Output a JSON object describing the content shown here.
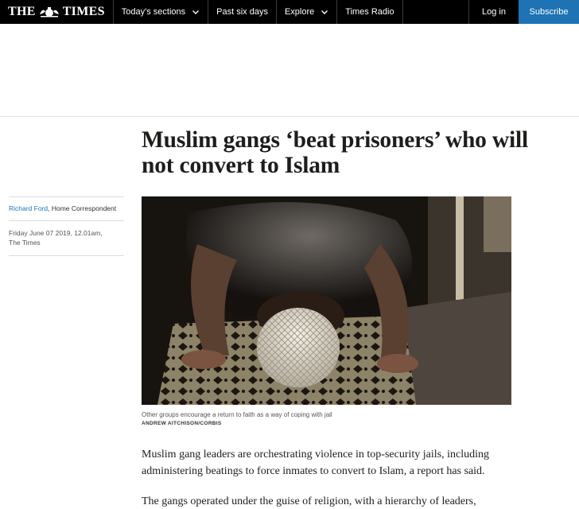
{
  "nav": {
    "logo_left": "THE",
    "logo_right": "TIMES",
    "items": [
      {
        "label": "Today's sections",
        "dropdown": true
      },
      {
        "label": "Past six days",
        "dropdown": false
      },
      {
        "label": "Explore",
        "dropdown": true
      },
      {
        "label": "Times Radio",
        "dropdown": false
      }
    ],
    "login": "Log in",
    "subscribe": "Subscribe"
  },
  "colors": {
    "nav_bg": "#000000",
    "subscribe_bg": "#1d73b3",
    "author_link": "#1d73b3"
  },
  "article": {
    "headline": "Muslim gangs ‘beat prisoners’ who will not convert to Islam",
    "author": "Richard Ford",
    "author_role": ", Home Correspondent",
    "date": "Friday June 07 2019, 12.01am,",
    "publication": "The Times",
    "image_caption": "Other groups encourage a return to faith as a way of coping with jail",
    "image_credit": "ANDREW AITCHISON/CORBIS",
    "paragraphs": [
      "Muslim gang leaders are orchestrating violence in top-security jails, including administering beatings to force inmates to convert to Islam, a report has said.",
      "The gangs operated under the guise of religion, with a hierarchy of leaders,"
    ]
  }
}
